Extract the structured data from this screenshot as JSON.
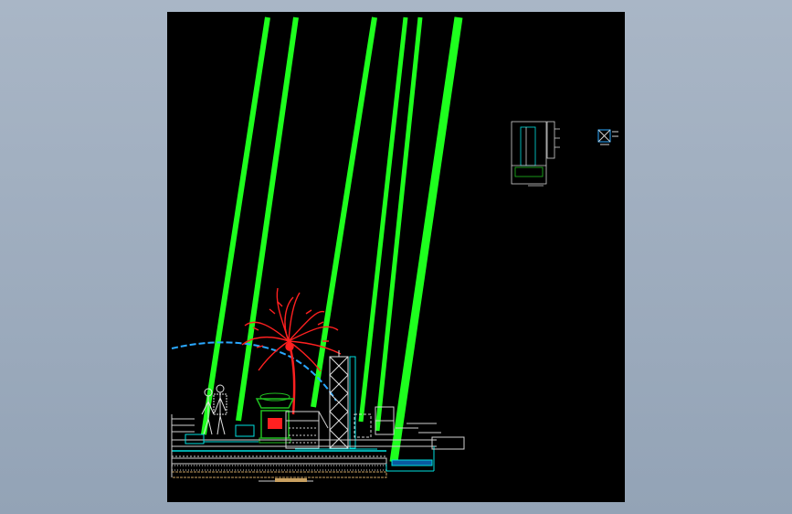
{
  "viewer": {
    "background_color": "#000000",
    "frame_color": "#9aa9bc"
  },
  "drawing": {
    "colors": {
      "light_beam": "#1eff1e",
      "palm": "#ff2020",
      "arc": "#2aa8ff",
      "line_work": "#d0d0d0",
      "cyan_detail": "#00e0e0",
      "accent_green": "#20c020"
    },
    "icons": [
      "cad-drawing-canvas",
      "detail-thumbnail-icon",
      "small-square-icon"
    ]
  }
}
